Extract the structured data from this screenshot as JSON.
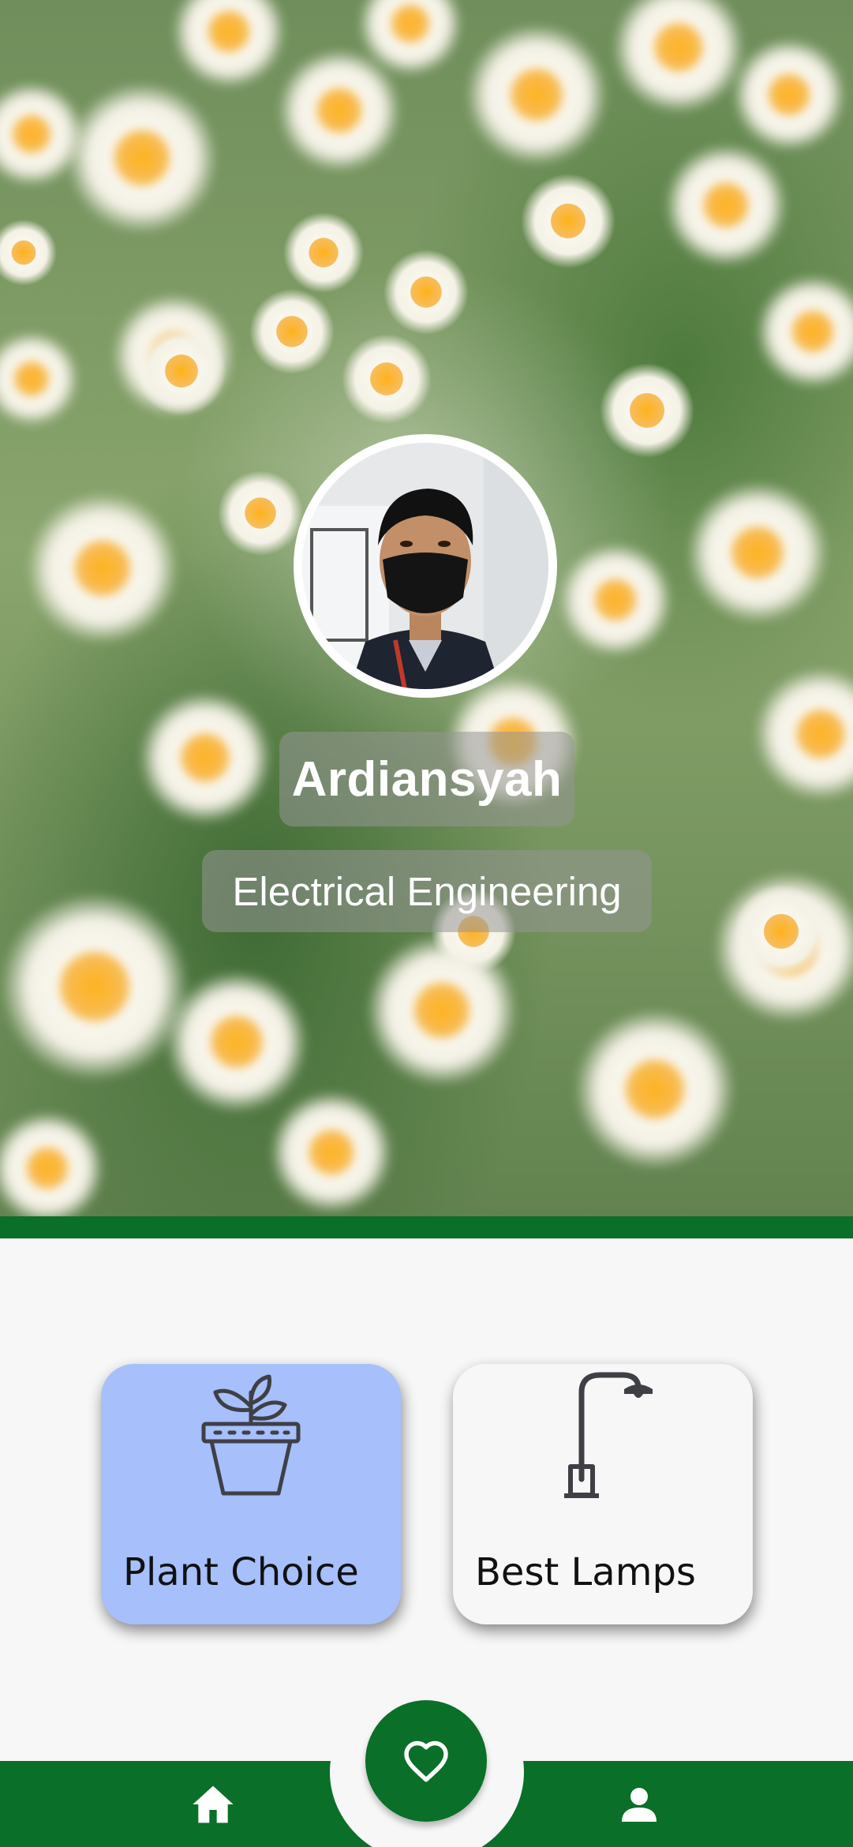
{
  "profile": {
    "name": "Ardiansyah",
    "subtitle": "Electrical Engineering"
  },
  "cards": [
    {
      "label": "Plant Choice",
      "icon": "potted-plant-icon",
      "background": "#a7bffb"
    },
    {
      "label": "Best Lamps",
      "icon": "street-lamp-icon",
      "background": "#f7f7f7"
    }
  ],
  "bottom_nav": {
    "items": [
      {
        "icon": "home-icon"
      },
      {
        "icon": "heart-icon",
        "active": true
      },
      {
        "icon": "person-icon"
      }
    ]
  },
  "colors": {
    "primary_green": "#0a6f28",
    "card_blue": "#a7bffb",
    "page_bg": "#f7f7f7"
  }
}
